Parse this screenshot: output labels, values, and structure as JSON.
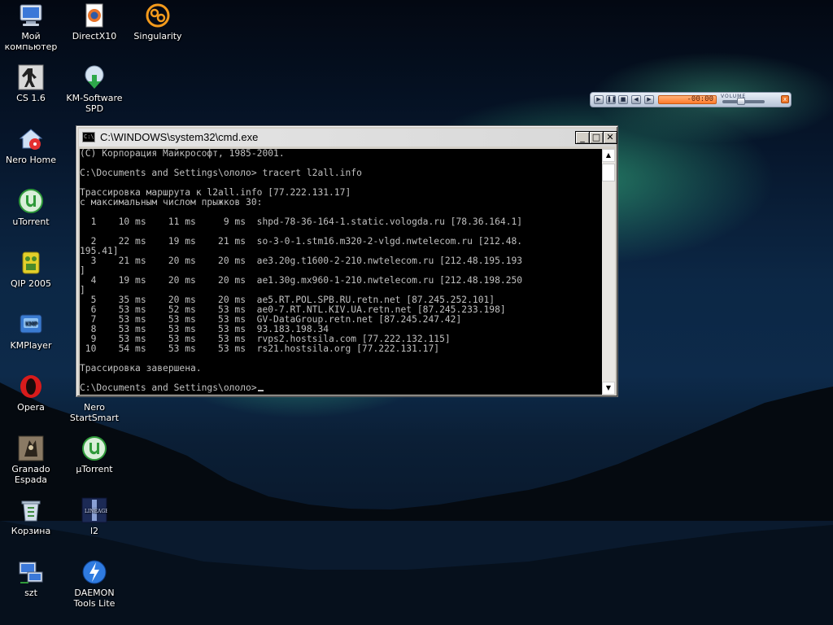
{
  "desktop": {
    "icons": [
      {
        "label": "Мой компьютер"
      },
      {
        "label": "DirectX10"
      },
      {
        "label": "Singularity"
      },
      {
        "label": "CS 1.6"
      },
      {
        "label": "KM-Software SPD"
      },
      {
        "label": "Nero Home"
      },
      {
        "label": "uTorrent"
      },
      {
        "label": "QIP 2005"
      },
      {
        "label": "KMPlayer"
      },
      {
        "label": "Opera"
      },
      {
        "label": "Nero StartSmart"
      },
      {
        "label": "Granado Espada"
      },
      {
        "label": "µTorrent"
      },
      {
        "label": "Корзина"
      },
      {
        "label": "l2"
      },
      {
        "label": "szt"
      },
      {
        "label": "DAEMON Tools Lite"
      }
    ]
  },
  "player": {
    "time": "-00:00",
    "volume_label": "VOLUME",
    "volume_level": 0.45
  },
  "cmd": {
    "title": "C:\\WINDOWS\\system32\\cmd.exe",
    "minimize": "_",
    "maximize": "□",
    "close": "✕",
    "scroll_up": "▲",
    "scroll_down": "▼",
    "lines": [
      "(C) Корпорация Майкрософт, 1985-2001.",
      "",
      "C:\\Documents and Settings\\ололо> tracert l2all.info",
      "",
      "Трассировка маршрута к l2all.info [77.222.131.17]",
      "с максимальным числом прыжков 30:",
      "",
      "  1    10 ms    11 ms     9 ms  shpd-78-36-164-1.static.vologda.ru [78.36.164.1]",
      "",
      "  2    22 ms    19 ms    21 ms  so-3-0-1.stm16.m320-2-vlgd.nwtelecom.ru [212.48.",
      "195.41]",
      "  3    21 ms    20 ms    20 ms  ae3.20g.t1600-2-210.nwtelecom.ru [212.48.195.193",
      "]",
      "  4    19 ms    20 ms    20 ms  ae1.30g.mx960-1-210.nwtelecom.ru [212.48.198.250",
      "]",
      "  5    35 ms    20 ms    20 ms  ae5.RT.POL.SPB.RU.retn.net [87.245.252.101]",
      "  6    53 ms    52 ms    53 ms  ae0-7.RT.NTL.KIV.UA.retn.net [87.245.233.198]",
      "  7    53 ms    53 ms    53 ms  GV-DataGroup.retn.net [87.245.247.42]",
      "  8    53 ms    53 ms    53 ms  93.183.198.34",
      "  9    53 ms    53 ms    53 ms  rvps2.hostsila.com [77.222.132.115]",
      " 10    54 ms    53 ms    53 ms  rs21.hostsila.org [77.222.131.17]",
      "",
      "Трассировка завершена.",
      "",
      "C:\\Documents and Settings\\ололо>"
    ]
  }
}
